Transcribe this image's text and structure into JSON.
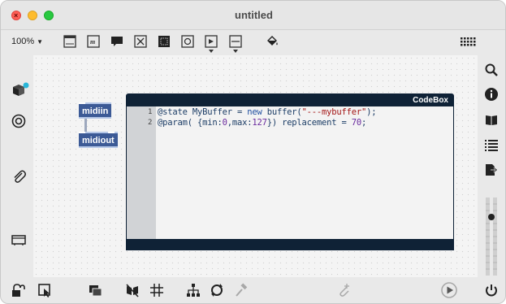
{
  "window": {
    "title": "untitled"
  },
  "toolbar": {
    "zoom": "100%"
  },
  "objects": [
    {
      "label": "midiin"
    },
    {
      "label": "midiout"
    }
  ],
  "codebox": {
    "header": "CodeBox",
    "lines": [
      {
        "num": "1",
        "text": "@state MyBuffer = new buffer(\"---mybuffer\");"
      },
      {
        "num": "2",
        "text": "@param( {min:0,max:127}) replacement = 70;"
      }
    ]
  },
  "colors": {
    "object_bg": "#3c5a96",
    "codebox_header": "#0f2236",
    "traffic_close": "#ff5f57",
    "traffic_min": "#febc2e",
    "traffic_max": "#28c840",
    "accent": "#29b6d8"
  },
  "icons": {
    "toolbar": [
      "presentation-icon",
      "comment-icon",
      "message-icon",
      "button-icon",
      "toggle-icon",
      "number-icon",
      "dial-icon",
      "slider-icon",
      "paint-bucket-icon",
      "grid-keyboard-icon"
    ],
    "left": [
      "package-icon",
      "target-icon",
      "paperclip-icon",
      "presentation-mode-icon"
    ],
    "right": [
      "search-icon",
      "info-icon",
      "book-icon",
      "list-icon",
      "export-icon",
      "level-meter-icon"
    ],
    "bottom": [
      "lock-icon",
      "selection-icon",
      "layers-icon",
      "no-edit-icon",
      "grid-icon",
      "hierarchy-icon",
      "refresh-icon",
      "hammer-icon",
      "add-connection-icon",
      "play-icon",
      "power-icon"
    ]
  }
}
